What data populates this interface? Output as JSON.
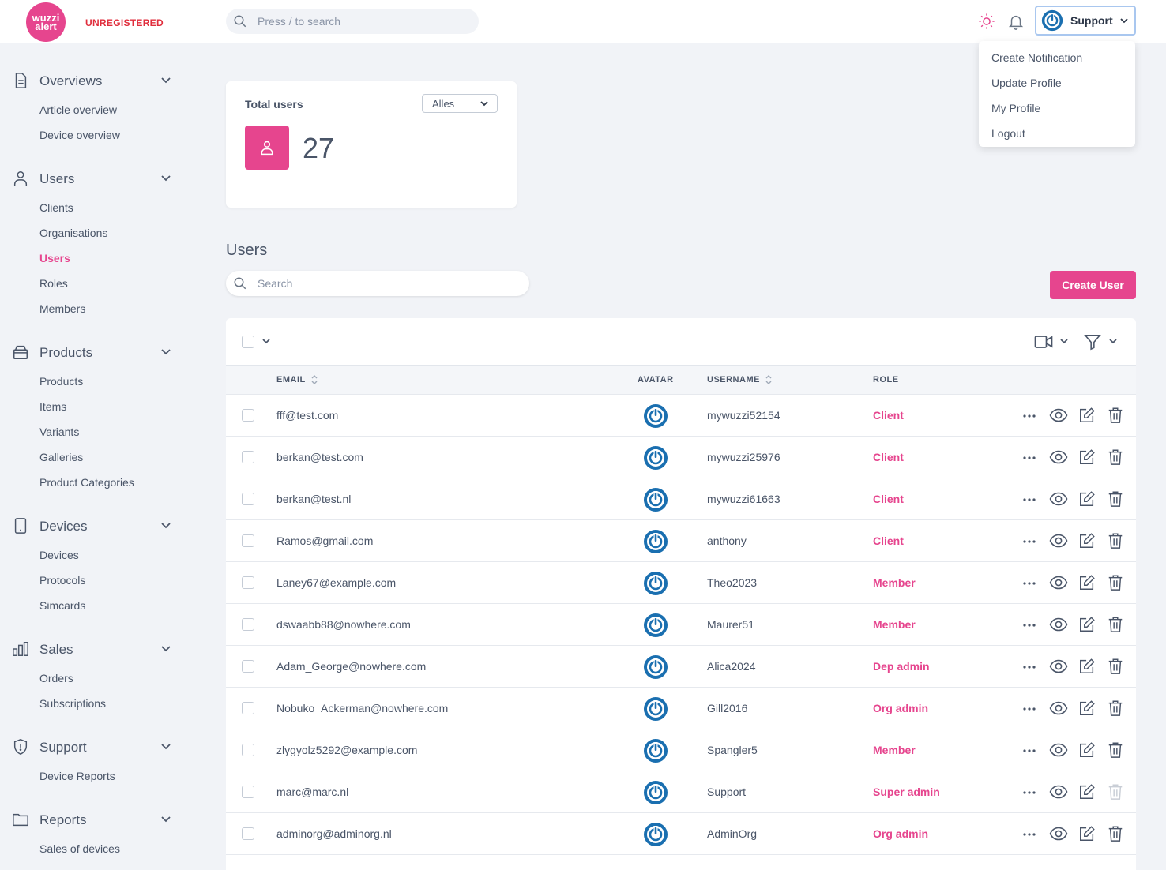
{
  "brand": {
    "logo_line1": "wuzzi",
    "logo_line2": "alert",
    "status": "UNREGISTERED"
  },
  "topbar": {
    "search_placeholder": "Press / to search",
    "user_name": "Support"
  },
  "user_menu": [
    "Create Notification",
    "Update Profile",
    "My Profile",
    "Logout"
  ],
  "sidebar": [
    {
      "title": "Overviews",
      "icon": "document-icon",
      "items": [
        "Article overview",
        "Device overview"
      ]
    },
    {
      "title": "Users",
      "icon": "user-icon",
      "items": [
        "Clients",
        "Organisations",
        "Users",
        "Roles",
        "Members"
      ]
    },
    {
      "title": "Products",
      "icon": "box-icon",
      "items": [
        "Products",
        "Items",
        "Variants",
        "Galleries",
        "Product Categories"
      ]
    },
    {
      "title": "Devices",
      "icon": "phone-icon",
      "items": [
        "Devices",
        "Protocols",
        "Simcards"
      ]
    },
    {
      "title": "Sales",
      "icon": "bar-chart-icon",
      "items": [
        "Orders",
        "Subscriptions"
      ]
    },
    {
      "title": "Support",
      "icon": "shield-icon",
      "items": [
        "Device Reports"
      ]
    },
    {
      "title": "Reports",
      "icon": "folder-icon",
      "items": [
        "Sales of devices"
      ]
    }
  ],
  "active_item": "Users",
  "stats": {
    "title": "Total users",
    "filter": "Alles",
    "value": "27"
  },
  "page": {
    "title": "Users",
    "search_placeholder": "Search",
    "create_label": "Create User"
  },
  "table": {
    "columns": {
      "email": "EMAIL",
      "avatar": "AVATAR",
      "username": "USERNAME",
      "role": "ROLE"
    },
    "rows": [
      {
        "email": "fff@test.com",
        "username": "mywuzzi52154",
        "role": "Client"
      },
      {
        "email": "berkan@test.com",
        "username": "mywuzzi25976",
        "role": "Client"
      },
      {
        "email": "berkan@test.nl",
        "username": "mywuzzi61663",
        "role": "Client"
      },
      {
        "email": "Ramos@gmail.com",
        "username": "anthony",
        "role": "Client"
      },
      {
        "email": "Laney67@example.com",
        "username": "Theo2023",
        "role": "Member"
      },
      {
        "email": "dswaabb88@nowhere.com",
        "username": "Maurer51",
        "role": "Member"
      },
      {
        "email": "Adam_George@nowhere.com",
        "username": "Alica2024",
        "role": "Dep admin"
      },
      {
        "email": "Nobuko_Ackerman@nowhere.com",
        "username": "Gill2016",
        "role": "Org admin"
      },
      {
        "email": "zlygyolz5292@example.com",
        "username": "Spangler5",
        "role": "Member"
      },
      {
        "email": "marc@marc.nl",
        "username": "Support",
        "role": "Super admin",
        "delete_disabled": true
      },
      {
        "email": "adminorg@adminorg.nl",
        "username": "AdminOrg",
        "role": "Org admin"
      }
    ]
  },
  "colors": {
    "accent": "#e6458e",
    "avatar": "#1a6fb0",
    "warning": "#e02d3c"
  }
}
